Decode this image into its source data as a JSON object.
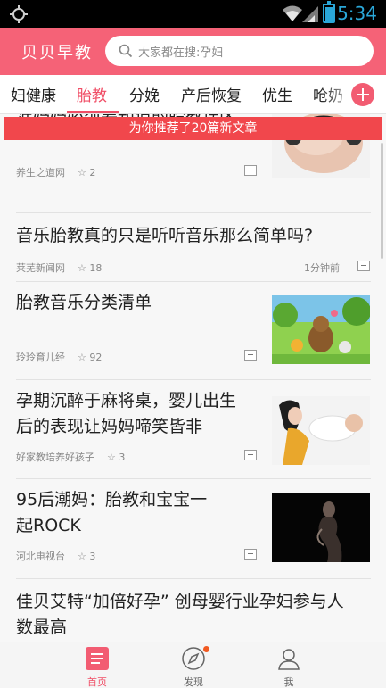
{
  "status_bar": {
    "time": "5:34",
    "accent_color": "#2aa7d8"
  },
  "header": {
    "app_title": "贝贝早教",
    "search_placeholder": "大家都在搜:孕妇",
    "background_color": "#f56277"
  },
  "tabs": {
    "items": [
      "妇健康",
      "胎教",
      "分娩",
      "产后恢复",
      "优生",
      "呛奶"
    ],
    "active": "胎教",
    "add_icon": "plus-circle-icon"
  },
  "toast": {
    "text": "为你推荐了20篇新文章",
    "color": "#f1474c"
  },
  "articles": [
    {
      "title": "准妈妈必须要知道的胎教误区",
      "source": "养生之道网",
      "stars": "2",
      "time": "",
      "thumbnail": "pregnant-belly-headphones"
    },
    {
      "title": "音乐胎教真的只是听听音乐那么简单吗?",
      "source": "莱芜新闻网",
      "stars": "18",
      "time": "1分钟前",
      "thumbnail": ""
    },
    {
      "title": "胎教音乐分类清单",
      "source": "玲玲育儿经",
      "stars": "92",
      "time": "",
      "thumbnail": "cartoon-forest-animals"
    },
    {
      "title": "孕期沉醉于麻将桌，婴儿出生后的表现让妈妈啼笑皆非",
      "title_line1": "孕期沉醉于麻将桌，婴儿出生",
      "title_line2": "后的表现让妈妈啼笑皆非",
      "source": "好家教培养好孩子",
      "stars": "3",
      "time": "",
      "thumbnail": "mother-holding-baby"
    },
    {
      "title": "95后潮妈：胎教和宝宝一起ROCK",
      "title_line1": "95后潮妈：胎教和宝宝一",
      "title_line2": "起ROCK",
      "source": "河北电视台",
      "stars": "3",
      "time": "",
      "thumbnail": "pregnant-silhouette"
    },
    {
      "title_line1": "佳贝艾特“加倍好孕” 创母婴行业孕妇参与人",
      "title_line2": "数最高",
      "source": "",
      "stars": "",
      "time": ""
    }
  ],
  "bottom_nav": [
    {
      "label": "首页",
      "icon": "home-list-icon",
      "active": true
    },
    {
      "label": "发现",
      "icon": "compass-icon",
      "active": false,
      "badge": true
    },
    {
      "label": "我",
      "icon": "person-icon",
      "active": false
    }
  ]
}
